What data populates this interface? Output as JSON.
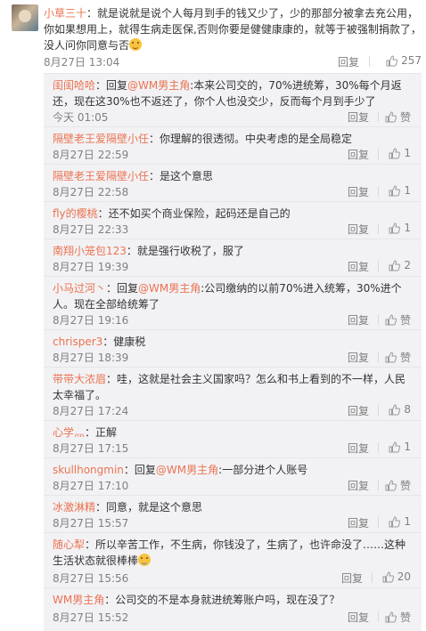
{
  "top_comment": {
    "user": "小草三十",
    "text": "：就是说就是说个人每月到手的钱又少了，少的那部分被拿去充公用，你如果想用上，就得生病走医保,否则你要是健健康康的，就等于被强制捐款了，没人问你同意与否",
    "time": "8月27日 13:04",
    "reply_label": "回复",
    "likes": "257"
  },
  "replies": [
    {
      "user": "闺闺哈哈",
      "prefix": "：回复",
      "mention": "@WM男主角",
      "text": ":本来公司交的，70%进统筹，30%每个月返还，现在这30%也不返还了，你个人也没交少，反而每个月到手少了",
      "time": "今天 01:05",
      "reply_label": "回复",
      "likes": "赞"
    },
    {
      "user": "隔壁老王爱隔壁小任",
      "prefix": "",
      "mention": "",
      "text": "：你理解的很透彻。中央考虑的是全局稳定",
      "time": "8月27日 22:59",
      "reply_label": "回复",
      "likes": "1"
    },
    {
      "user": "隔壁老王爱隔壁小任",
      "prefix": "",
      "mention": "",
      "text": "：是这个意思",
      "time": "8月27日 22:58",
      "reply_label": "回复",
      "likes": "1"
    },
    {
      "user": "fly的樱桃",
      "prefix": "",
      "mention": "",
      "text": "：还不如买个商业保险，起码还是自己的",
      "time": "8月27日 22:33",
      "reply_label": "回复",
      "likes": "1"
    },
    {
      "user": "南翔小笼包123",
      "prefix": "",
      "mention": "",
      "text": "：就是强行收税了，服了",
      "time": "8月27日 19:39",
      "reply_label": "回复",
      "likes": "2"
    },
    {
      "user": "小马过河丶",
      "prefix": "：回复",
      "mention": "@WM男主角",
      "text": ":公司缴纳的以前70%进入统筹，30%进个人。现在全部给统筹了",
      "time": "8月27日 19:16",
      "reply_label": "回复",
      "likes": "赞"
    },
    {
      "user": "chrisper3",
      "prefix": "",
      "mention": "",
      "text": "：健康税",
      "time": "8月27日 18:39",
      "reply_label": "回复",
      "likes": "赞"
    },
    {
      "user": "带带大浓眉",
      "prefix": "",
      "mention": "",
      "text": "：哇，这就是社会主义国家吗？怎么和书上看到的不一样，人民太幸福了。",
      "time": "8月27日 17:24",
      "reply_label": "回复",
      "likes": "8"
    },
    {
      "user": "心学灬",
      "prefix": "",
      "mention": "",
      "text": "：正解",
      "time": "8月27日 17:15",
      "reply_label": "回复",
      "likes": "1"
    },
    {
      "user": "skullhongmin",
      "prefix": "：回复",
      "mention": "@WM男主角",
      "text": ":一部分进个人账号",
      "time": "8月27日 17:10",
      "reply_label": "回复",
      "likes": "赞"
    },
    {
      "user": "冰激淋精",
      "prefix": "",
      "mention": "",
      "text": "：同意，就是这个意思",
      "time": "8月27日 15:57",
      "reply_label": "回复",
      "likes": "1"
    },
    {
      "user": "随心犁",
      "prefix": "",
      "mention": "",
      "text": "：所以辛苦工作，不生病，你钱没了，生病了，也许命没了……这种生活状态就很棒棒",
      "time": "8月27日 15:56",
      "reply_label": "回复",
      "likes": "20"
    },
    {
      "user": "WM男主角",
      "prefix": "",
      "mention": "",
      "text": "：公司交的不是本身就进统筹账户吗，现在没了？",
      "time": "8月27日 15:52",
      "reply_label": "回复",
      "likes": "赞"
    }
  ]
}
